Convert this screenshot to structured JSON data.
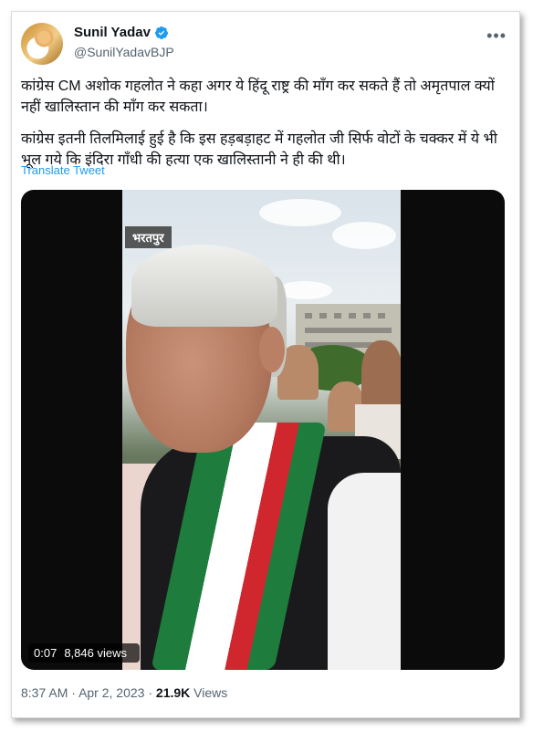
{
  "tweet": {
    "author": {
      "display_name": "Sunil Yadav",
      "handle": "@SunilYadavBJP",
      "verified": true
    },
    "text_paragraphs": [
      "कांग्रेस CM अशोक गहलोत ने कहा अगर ये हिंदू राष्ट्र की माँग कर सकते हैं तो अमृतपाल क्यों नहीं खालिस्तान की माँग कर सकता।",
      "कांग्रेस इतनी तिलमिलाई हुई है कि इस हड़बड़ाहट में गहलोत जी सिर्फ वोटों के चक्कर में ये भी भूल गये कि इंदिरा गाँधी की हत्या एक खालिस्तानी ने ही की थी।"
    ],
    "translate_label": "Translate Tweet",
    "more_label": "•••",
    "media": {
      "location_tag": "भरतपुर",
      "duration": "0:07",
      "views": "8,846 views"
    },
    "footer": {
      "time": "8:37 AM",
      "separator": "·",
      "date": "Apr 2, 2023",
      "view_count": "21.9K",
      "views_label": "Views"
    }
  },
  "colors": {
    "accent": "#1d9bf0",
    "text": "#0f1419",
    "muted": "#536471"
  }
}
